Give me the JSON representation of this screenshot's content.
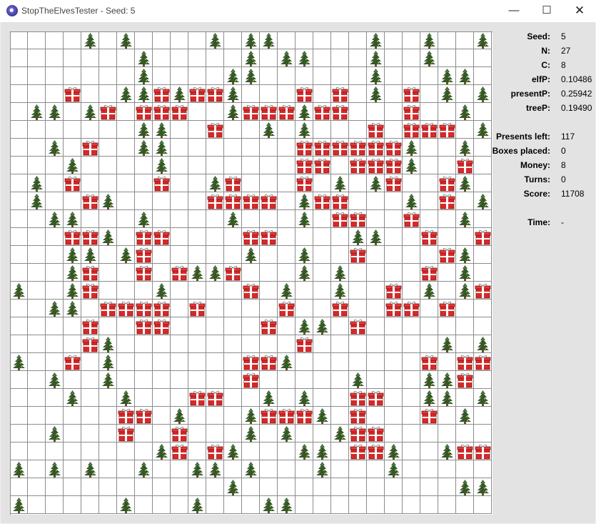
{
  "window": {
    "title": "StopTheElvesTester - Seed: 5",
    "minimize_glyph": "—",
    "maximize_glyph": "☐",
    "close_glyph": "✕"
  },
  "stats": [
    {
      "label": "Seed:",
      "value": "5"
    },
    {
      "label": "N:",
      "value": "27"
    },
    {
      "label": "C:",
      "value": "8"
    },
    {
      "label": "elfP:",
      "value": "0.10486"
    },
    {
      "label": "presentP:",
      "value": "0.25942"
    },
    {
      "label": "treeP:",
      "value": "0.19490"
    },
    {
      "label": "Presents left:",
      "value": "117"
    },
    {
      "label": "Boxes placed:",
      "value": "0"
    },
    {
      "label": "Money:",
      "value": "8"
    },
    {
      "label": "Turns:",
      "value": "0"
    },
    {
      "label": "Score:",
      "value": "11708"
    },
    {
      "label": "Time:",
      "value": "-"
    }
  ],
  "board": {
    "size": 27,
    "legend": {
      "T": "tree",
      "P": "present",
      ".": "empty"
    },
    "rows": [
      "....T.T.....T.TT......T..T....T",
      "...........................",
      "...........................",
      "...........................",
      "...........................",
      "...........................",
      "...........................",
      "...........................",
      "...........................",
      "...........................",
      "...........................",
      "...........................",
      "...........................",
      "...........................",
      "...........................",
      "...........................",
      "...........................",
      "...........................",
      "...........................",
      "...........................",
      "...........................",
      "...........................",
      "...........................",
      "...........................",
      "...........................",
      "...........................",
      "..........................."
    ]
  }
}
